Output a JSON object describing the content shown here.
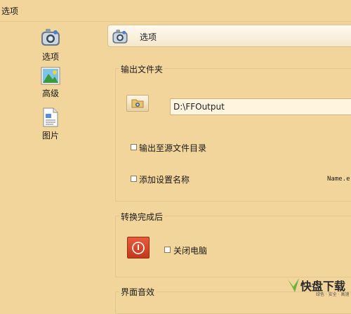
{
  "window": {
    "title": "选项"
  },
  "sidebar": {
    "items": [
      {
        "label": "选项",
        "icon": "options-icon"
      },
      {
        "label": "高级",
        "icon": "picture-icon"
      },
      {
        "label": "图片",
        "icon": "document-icon"
      }
    ]
  },
  "header": {
    "title": "选项",
    "icon": "options-icon"
  },
  "output_group": {
    "title": "输出文件夹",
    "folder_path": "D:\\FFOutput",
    "checkbox_source_dir": {
      "label": "输出至源文件目录",
      "checked": false
    },
    "checkbox_add_name": {
      "label": "添加设置名称",
      "checked": false
    },
    "name_preview": "Name.e"
  },
  "after_convert_group": {
    "title": "转换完成后",
    "checkbox_shutdown": {
      "label": "关闭电脑",
      "checked": false
    }
  },
  "sound_group": {
    "title": "界面音效"
  },
  "watermark": {
    "brand": "快盘下载",
    "sub": "绿色 · 安全 · 高速"
  },
  "colors": {
    "background": "#f2d59b",
    "power_button": "#d9482a"
  }
}
